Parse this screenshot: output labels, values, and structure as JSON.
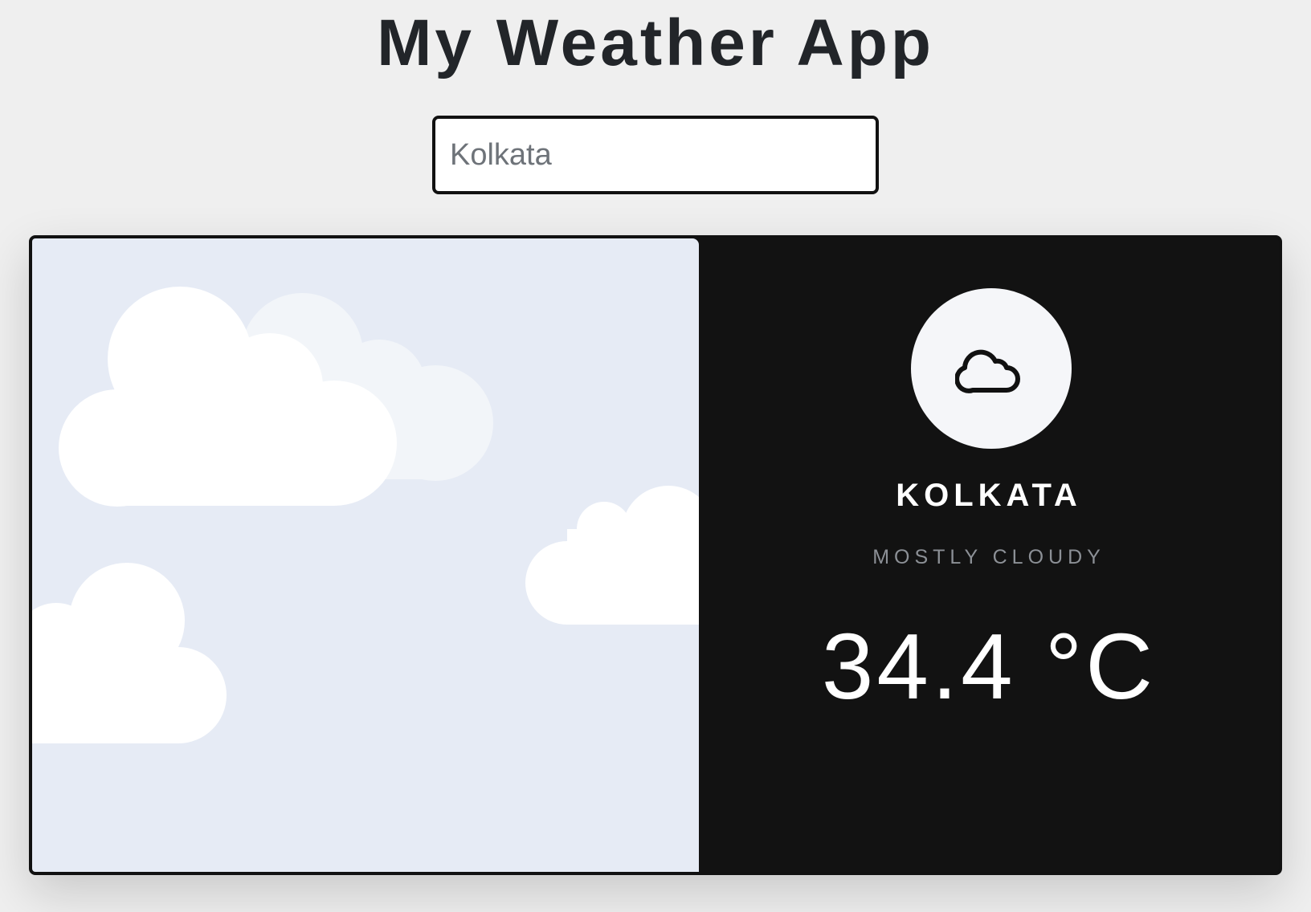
{
  "app": {
    "title": "My Weather App"
  },
  "search": {
    "value": "Kolkata",
    "placeholder": ""
  },
  "weather": {
    "city": "KOLKATA",
    "condition": "MOSTLY CLOUDY",
    "temperature": "34.4 °C",
    "icon": "cloud-icon"
  },
  "colors": {
    "sky_background": "#e6ebf5",
    "panel_background": "#121212",
    "cloud": "#ffffff",
    "cloud_faded": "#f2f5f9",
    "icon_circle": "#f5f6f9"
  }
}
